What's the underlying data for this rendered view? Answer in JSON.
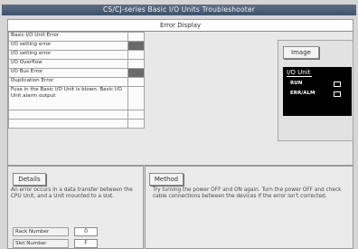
{
  "window": {
    "title": "CS/CJ-series Basic I/O Units Troubleshooter"
  },
  "error_display": {
    "header": "Error Display",
    "rows": [
      {
        "label": "Basic I/O Unit Error",
        "active": false
      },
      {
        "label": "I/O setting error",
        "active": true
      },
      {
        "label": "I/O setting error",
        "active": false
      },
      {
        "label": "I/O Overflow",
        "active": false
      },
      {
        "label": "I/O Bus Error",
        "active": true
      },
      {
        "label": "Duplication Error",
        "active": false
      },
      {
        "label": "Fuse in the Basic I/O Unit is blown. Basic I/O Unit alarm output",
        "active": false
      },
      {
        "label": "",
        "active": false
      },
      {
        "label": "",
        "active": false
      }
    ]
  },
  "image_panel": {
    "button_label": "Image",
    "unit_label": "I/O Unit",
    "leds": [
      {
        "label": "RUN"
      },
      {
        "label": "ERR/ALM"
      }
    ]
  },
  "details": {
    "button_label": "Details",
    "text": "An error occurs in a data transfer between the CPU Unit, and a Unit mounted to a slot.",
    "rack_label": "Rack Number",
    "rack_value": "0",
    "slot_label": "Slot Number",
    "slot_value": "F"
  },
  "method": {
    "button_label": "Method",
    "text": "Try turning the power OFF and ON again. Turn the power OFF and check cable connections between the devices if the error isn't corrected."
  }
}
